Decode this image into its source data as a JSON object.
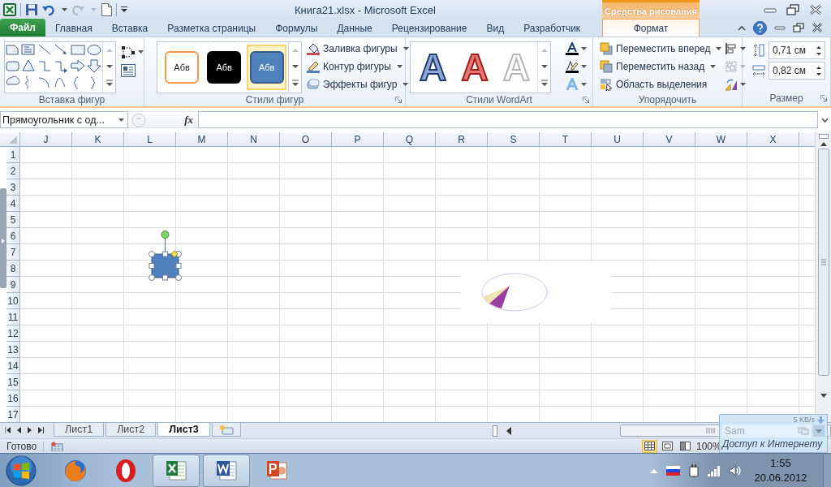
{
  "window": {
    "title": "Книга21.xlsx - Microsoft Excel",
    "context_group": "Средства рисования"
  },
  "tabs": [
    {
      "label": "Файл",
      "kind": "file",
      "selected": false
    },
    {
      "label": "Главная",
      "kind": "normal",
      "selected": false
    },
    {
      "label": "Вставка",
      "kind": "normal",
      "selected": false
    },
    {
      "label": "Разметка страницы",
      "kind": "normal",
      "selected": false
    },
    {
      "label": "Формулы",
      "kind": "normal",
      "selected": false
    },
    {
      "label": "Данные",
      "kind": "normal",
      "selected": false
    },
    {
      "label": "Рецензирование",
      "kind": "normal",
      "selected": false
    },
    {
      "label": "Вид",
      "kind": "normal",
      "selected": false
    },
    {
      "label": "Разработчик",
      "kind": "normal",
      "selected": false
    },
    {
      "label": "Формат",
      "kind": "contextual",
      "selected": true
    }
  ],
  "ribbon": {
    "insert_shapes": {
      "label": "Вставка фигур"
    },
    "shape_styles": {
      "label": "Стили фигур",
      "presets": [
        {
          "text": "Абв",
          "selected": false
        },
        {
          "text": "Абв",
          "selected": false
        },
        {
          "text": "Абв",
          "selected": true
        }
      ],
      "commands": [
        {
          "label": "Заливка фигуры",
          "kind": "fill"
        },
        {
          "label": "Контур фигуры",
          "kind": "outline"
        },
        {
          "label": "Эффекты фигур",
          "kind": "effects"
        }
      ]
    },
    "wordart": {
      "label": "Стили WordArt",
      "presets": [
        {
          "text": "A"
        },
        {
          "text": "A"
        },
        {
          "text": "A"
        }
      ]
    },
    "arrange": {
      "label": "Упорядочить",
      "commands": [
        {
          "label": "Переместить вперед",
          "kind": "forward"
        },
        {
          "label": "Переместить назад",
          "kind": "backward"
        },
        {
          "label": "Область выделения",
          "kind": "selection"
        }
      ]
    },
    "size": {
      "label": "Размер",
      "height": "0,71 см",
      "width": "0,82 см"
    }
  },
  "formula_bar": {
    "name_box": "Прямоугольник с од...",
    "function_button": "fx"
  },
  "sheet": {
    "columns": [
      "J",
      "K",
      "L",
      "M",
      "N",
      "O",
      "P",
      "Q",
      "R",
      "S",
      "T",
      "U",
      "V",
      "W",
      "X"
    ],
    "rows": [
      "1",
      "2",
      "3",
      "4",
      "5",
      "6",
      "7",
      "8",
      "9",
      "10",
      "11",
      "12",
      "13",
      "14",
      "15",
      "16",
      "17"
    ]
  },
  "sheet_tabs": [
    {
      "label": "Лист1",
      "selected": false
    },
    {
      "label": "Лист2",
      "selected": false
    },
    {
      "label": "Лист3",
      "selected": true
    }
  ],
  "status_bar": {
    "status": "Готово",
    "views": [
      {
        "kind": "normal",
        "selected": true
      },
      {
        "kind": "page_layout",
        "selected": false
      },
      {
        "kind": "page_break",
        "selected": false
      }
    ],
    "zoom": "100%"
  },
  "network_popup": {
    "speed": "5 KB/s",
    "network": "Sam",
    "status": "Доступ к Интернету"
  },
  "taskbar": {
    "apps": [
      {
        "kind": "firefox",
        "running": false
      },
      {
        "kind": "opera",
        "running": false
      },
      {
        "kind": "excel",
        "running": true
      },
      {
        "kind": "word",
        "running": true
      },
      {
        "kind": "powerpoint",
        "running": false
      }
    ],
    "clock": {
      "time": "1:55",
      "date": "20.06.2012"
    }
  }
}
